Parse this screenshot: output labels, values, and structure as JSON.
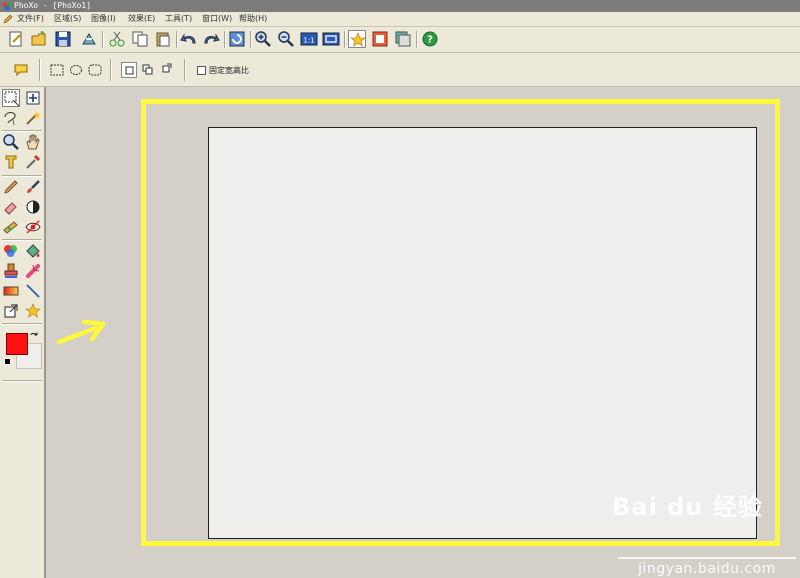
{
  "window": {
    "title": "PhoXo - [PhoXo1]"
  },
  "menu": [
    {
      "label": "文件(F)"
    },
    {
      "label": "区域(S)"
    },
    {
      "label": "图像(I)"
    },
    {
      "label": "效果(E)"
    },
    {
      "label": "工具(T)"
    },
    {
      "label": "窗口(W)"
    },
    {
      "label": "帮助(H)"
    }
  ],
  "toolbar": {
    "buttons": [
      "new-icon",
      "open-icon",
      "save-icon",
      "import-icon",
      "cut-icon",
      "copy-icon",
      "paste-icon",
      "undo-icon",
      "redo-icon",
      "refresh-icon",
      "zoom-in-icon",
      "zoom-out-icon",
      "actual-size-icon",
      "fit-window-icon",
      "effect-star-icon",
      "frame-icon",
      "layers-icon",
      "help-icon"
    ]
  },
  "options_bar": {
    "fix_ratio_label": "固定宽高比",
    "fix_ratio_checked": false
  },
  "colors": {
    "foreground": "#ff1010",
    "background": "#f0eeec",
    "highlight": "#fff93a"
  },
  "watermark": {
    "logo": "Bai du 经验",
    "url": "jingyan.baidu.com"
  }
}
